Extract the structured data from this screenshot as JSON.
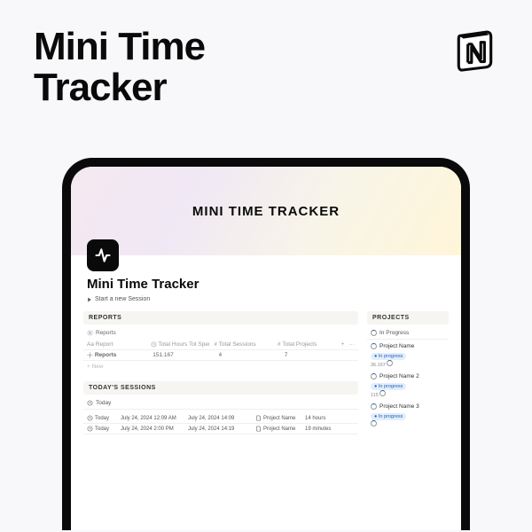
{
  "hero": {
    "line1": "Mini Time",
    "line2": "Tracker"
  },
  "app": {
    "header_title": "MINI TIME TRACKER",
    "page_title": "Mini Time Tracker",
    "start_session": "Start a new Session"
  },
  "reports": {
    "heading": "REPORTS",
    "toggle": "Reports",
    "cols": {
      "name": "Aa Report",
      "hours": "Total Hours Tot Spent",
      "sessions": "Total Sessions",
      "projects": "Total Projects"
    },
    "row": {
      "name": "Reports",
      "hours": "151.167",
      "sessions": "4",
      "projects": "7"
    },
    "new": "+ New"
  },
  "sessions": {
    "heading": "TODAY'S SESSIONS",
    "tab": "Today",
    "rows": [
      {
        "name": "Today",
        "start": "July 24, 2024 12:09 AM",
        "end": "July 24, 2024 14:09",
        "project": "Project Name",
        "dur": "14 hours"
      },
      {
        "name": "Today",
        "start": "July 24, 2024 2:00 PM",
        "end": "July 24, 2024 14:19",
        "project": "Project Name",
        "dur": "19 minutes"
      }
    ]
  },
  "projects": {
    "heading": "PROJECTS",
    "tab": "In Progress",
    "items": [
      {
        "name": "Project Name",
        "status": "In progress",
        "pct": "36.167"
      },
      {
        "name": "Project Name 2",
        "status": "In progress",
        "pct": "115"
      },
      {
        "name": "Project Name 3",
        "status": "In progress",
        "pct": ""
      }
    ]
  }
}
